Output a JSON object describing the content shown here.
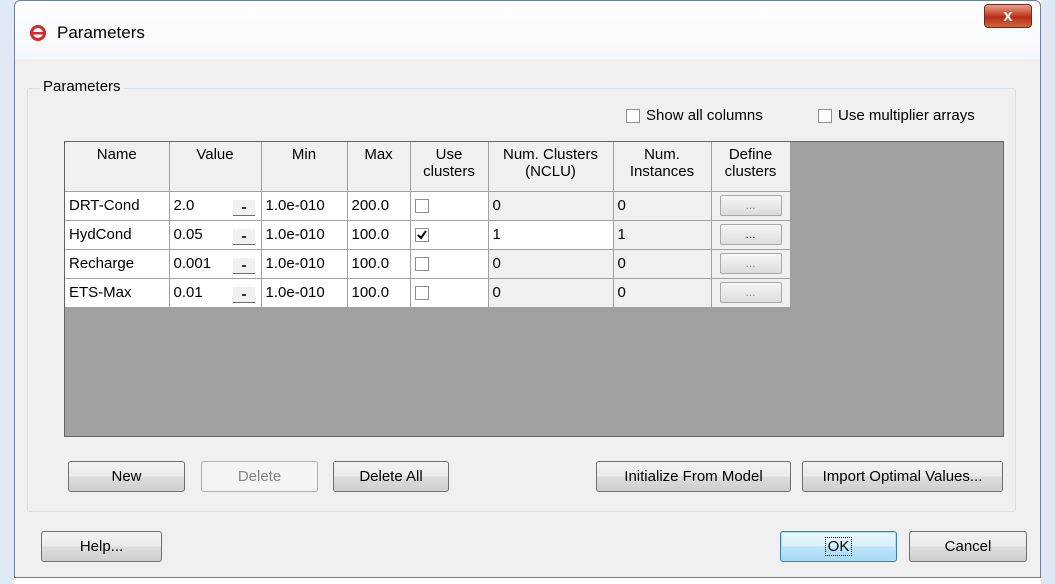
{
  "window": {
    "title": "Parameters"
  },
  "group": {
    "label": "Parameters"
  },
  "options": {
    "show_all_columns": "Show all columns",
    "use_multiplier_arrays": "Use multiplier arrays"
  },
  "table": {
    "headers": {
      "name": "Name",
      "value": "Value",
      "min": "Min",
      "max": "Max",
      "use_clusters_1": "Use",
      "use_clusters_2": "clusters",
      "num_clusters_1": "Num. Clusters",
      "num_clusters_2": "(NCLU)",
      "num_instances_1": "Num.",
      "num_instances_2": "Instances",
      "define_clusters_1": "Define",
      "define_clusters_2": "clusters"
    },
    "rows": [
      {
        "name": "DRT-Cond",
        "value": "2.0",
        "min": "1.0e-010",
        "max": "200.0",
        "use_clusters": false,
        "ncl": "0",
        "instances": "0",
        "define": "..."
      },
      {
        "name": "HydCond",
        "value": "0.05",
        "min": "1.0e-010",
        "max": "100.0",
        "use_clusters": true,
        "ncl": "1",
        "instances": "1",
        "define": "..."
      },
      {
        "name": "Recharge",
        "value": "0.001",
        "min": "1.0e-010",
        "max": "100.0",
        "use_clusters": false,
        "ncl": "0",
        "instances": "0",
        "define": "..."
      },
      {
        "name": "ETS-Max",
        "value": "0.01",
        "min": "1.0e-010",
        "max": "100.0",
        "use_clusters": false,
        "ncl": "0",
        "instances": "0",
        "define": "..."
      }
    ]
  },
  "buttons": {
    "new": "New",
    "delete": "Delete",
    "delete_all": "Delete All",
    "initialize": "Initialize From Model",
    "import": "Import Optimal Values...",
    "help": "Help...",
    "ok": "OK",
    "cancel": "Cancel"
  },
  "colors": {
    "grid_bg": "#a0a0a0",
    "close_red": "#c7432b",
    "default_button": "#3c7fb1"
  }
}
